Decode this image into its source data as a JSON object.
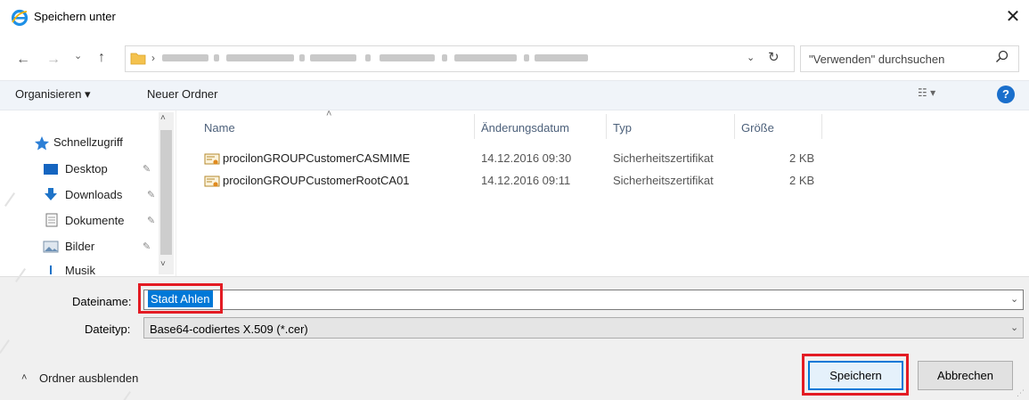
{
  "window": {
    "title": "Speichern unter",
    "close_glyph": "✕"
  },
  "nav": {
    "back_glyph": "←",
    "forward_glyph": "→",
    "recent_glyph": "⌄",
    "up_glyph": "↑",
    "address_chevron": "›",
    "address_dropdown": "⌄",
    "refresh_glyph": "↻"
  },
  "search": {
    "placeholder": "\"Verwenden\" durchsuchen"
  },
  "commandbar": {
    "organize_label": "Organisieren ▾",
    "new_folder_label": "Neuer Ordner",
    "view_label": "☷ ▾",
    "help_label": "?"
  },
  "sidebar": {
    "scroll_up": "˄",
    "scroll_down": "˅",
    "quick_access": "Schnellzugriff",
    "items": [
      {
        "label": "Desktop",
        "icon": "desktop-icon",
        "pinned": true
      },
      {
        "label": "Downloads",
        "icon": "downloads-icon",
        "pinned": true
      },
      {
        "label": "Dokumente",
        "icon": "documents-icon",
        "pinned": true
      },
      {
        "label": "Bilder",
        "icon": "pictures-icon",
        "pinned": true
      },
      {
        "label": "Musik",
        "icon": "music-icon",
        "pinned": false
      }
    ],
    "pin_glyph": "📌"
  },
  "filelist": {
    "sort_glyph": "˄",
    "columns": [
      "Name",
      "Änderungsdatum",
      "Typ",
      "Größe"
    ],
    "rows": [
      {
        "name": "procilonGROUPCustomerCASMIME",
        "date": "14.12.2016 09:30",
        "type": "Sicherheitszertifikat",
        "size": "2 KB"
      },
      {
        "name": "procilonGROUPCustomerRootCA01",
        "date": "14.12.2016 09:11",
        "type": "Sicherheitszertifikat",
        "size": "2 KB"
      }
    ]
  },
  "form": {
    "filename_label": "Dateiname:",
    "filename_value": "Stadt Ahlen",
    "filetype_label": "Dateityp:",
    "filetype_value": "Base64-codiertes X.509 (*.cer)",
    "dropdown_glyph": "⌄",
    "hide_folders_label": "Ordner ausblenden",
    "hide_folders_glyph": "˄",
    "save_label": "Speichern",
    "cancel_label": "Abbrechen",
    "grip_glyph": "⋰"
  },
  "colors": {
    "accent": "#0078d7",
    "highlight": "#e31b23",
    "commandbar_bg": "#f0f4f9"
  }
}
